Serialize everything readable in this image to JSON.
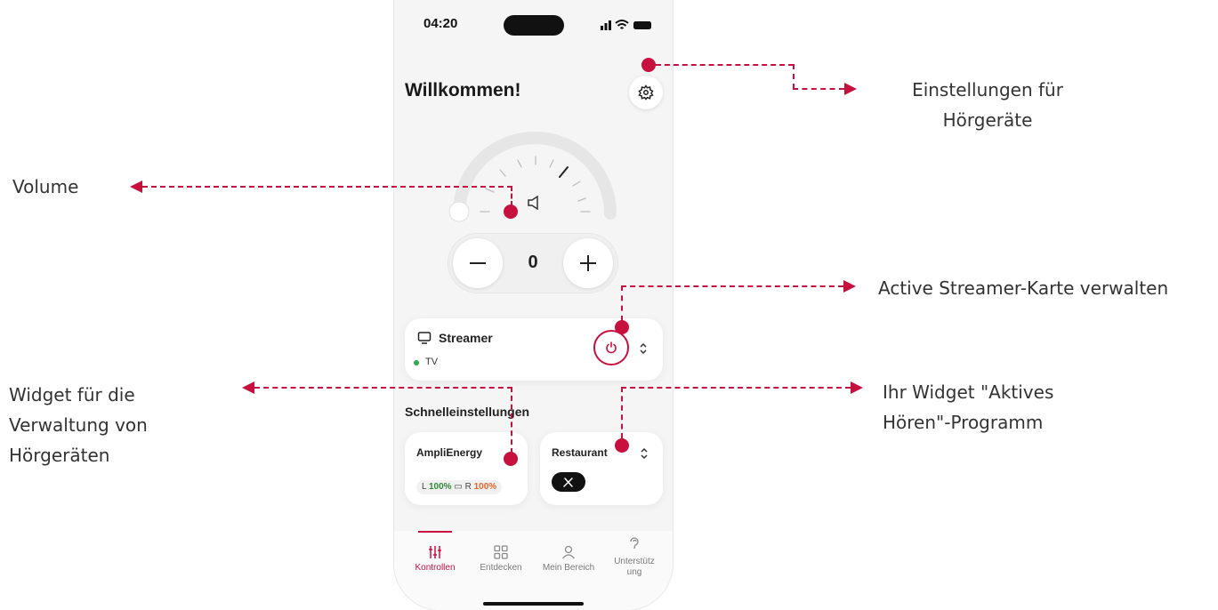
{
  "status_bar": {
    "time": "04:20"
  },
  "header": {
    "greeting": "Willkommen!"
  },
  "volume": {
    "value": "0"
  },
  "streamer": {
    "title": "Streamer",
    "source": "TV"
  },
  "quick_settings": {
    "title": "Schnelleinstellungen",
    "device": {
      "name": "AmpliEnergy",
      "left_prefix": "L",
      "left_value": "100%",
      "right_prefix": "R",
      "right_value": "100%"
    },
    "program": {
      "name": "Restaurant"
    }
  },
  "tabs": [
    {
      "label": "Kontrollen",
      "icon": "sliders-icon",
      "active": true
    },
    {
      "label": "Entdecken",
      "icon": "grid-icon",
      "active": false
    },
    {
      "label": "Mein Bereich",
      "icon": "user-icon",
      "active": false
    },
    {
      "label": "Unterstütz ung",
      "icon": "ear-icon",
      "active": false
    }
  ],
  "callouts": {
    "settings": "Einstellungen für Hörgeräte",
    "volume": "Volume",
    "streamer": "Active Streamer-Karte verwalten",
    "device_widget": "Widget für die Verwaltung von Hörgeräten",
    "program_widget": "Ihr Widget \"Aktives Hören\"-Programm"
  },
  "colors": {
    "accent": "#c8103e",
    "battery_left": "#2f8a3a",
    "battery_right": "#e2672a",
    "status_dot": "#2fa84f"
  }
}
